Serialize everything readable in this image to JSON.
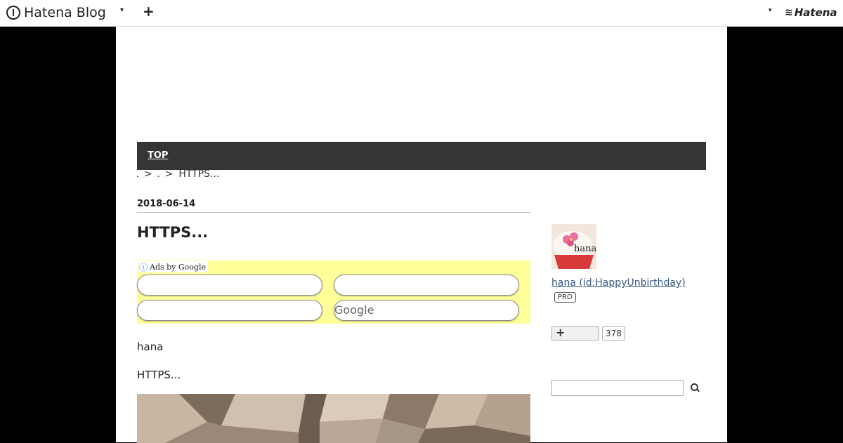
{
  "globalbar": {
    "logo_text": "Hatena Blog",
    "dropdown_caret": "▾",
    "add_button": "+",
    "account_caret": "▾",
    "hatena_mark": "≋",
    "hatena_text": "Hatena"
  },
  "nav": {
    "top_label": "TOP"
  },
  "breadcrumb": {
    "crumb1": "ˌ",
    "sep1": ">",
    "crumb2": "ˌ",
    "sep2": ">",
    "current": "HTTPS..."
  },
  "entry": {
    "date": "2018-06-14",
    "title": "HTTPS...",
    "author_text": "hana",
    "body_text": "HTTPS..."
  },
  "ads": {
    "label": "Ads by Google",
    "info_icon": "ⓘ",
    "pills": [
      "",
      "",
      "",
      "Google"
    ],
    "background": "#ffff99"
  },
  "sidebar": {
    "avatar_text": "hana",
    "profile_link": "hana (id:HappyUnbirthday)",
    "badge": "PRO",
    "star_plus": "+",
    "star_count": "378",
    "search_placeholder": ""
  },
  "colors": {
    "navbar": "#353535",
    "link": "#3a5a85",
    "page_bg": "#000000"
  }
}
